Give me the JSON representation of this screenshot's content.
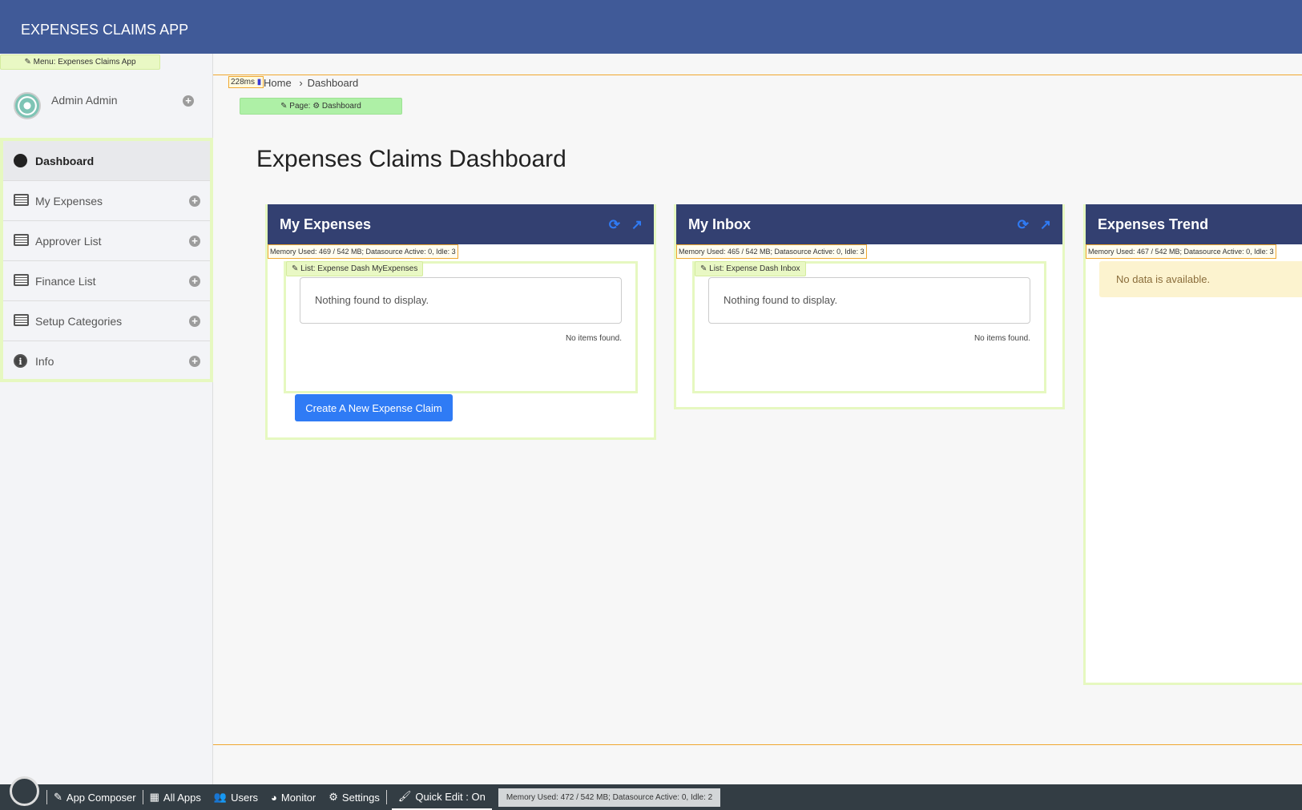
{
  "app": {
    "title": "EXPENSES CLAIMS APP"
  },
  "sidebar": {
    "menu_tag": "✎ Menu: Expenses Claims App",
    "user": "Admin Admin",
    "items": [
      {
        "label": "Dashboard",
        "icon": "dashboard-icon"
      },
      {
        "label": "My Expenses",
        "icon": "list-icon"
      },
      {
        "label": "Approver List",
        "icon": "list-icon"
      },
      {
        "label": "Finance List",
        "icon": "list-icon"
      },
      {
        "label": "Setup Categories",
        "icon": "list-icon"
      },
      {
        "label": "Info",
        "icon": "info-icon"
      }
    ]
  },
  "breadcrumb": {
    "timing": "228ms",
    "home": "Home",
    "sep": "›",
    "current": "Dashboard"
  },
  "page": {
    "tag": "✎ Page: ⚙ Dashboard",
    "title": "Expenses Claims Dashboard"
  },
  "panels": {
    "my_expenses": {
      "title": "My Expenses",
      "memory": "Memory Used: 469 / 542 MB; Datasource Active: 0, Idle: 3",
      "list_tag": "✎ List: Expense Dash MyExpenses",
      "empty": "Nothing found to display.",
      "no_items": "No items found.",
      "button": "Create A New Expense Claim"
    },
    "inbox": {
      "title": "My Inbox",
      "memory": "Memory Used: 465 / 542 MB; Datasource Active: 0, Idle: 3",
      "list_tag": "✎ List: Expense Dash Inbox",
      "empty": "Nothing found to display.",
      "no_items": "No items found."
    },
    "trend": {
      "title": "Expenses Trend",
      "memory": "Memory Used: 467 / 542 MB; Datasource Active: 0, Idle: 3",
      "no_data": "No data is available."
    }
  },
  "bottombar": {
    "app_composer": "App Composer",
    "all_apps": "All Apps",
    "users": "Users",
    "monitor": "Monitor",
    "settings": "Settings",
    "quick_edit": "Quick Edit : On",
    "memory": "Memory Used: 472 / 542 MB; Datasource Active: 0, Idle: 2"
  }
}
